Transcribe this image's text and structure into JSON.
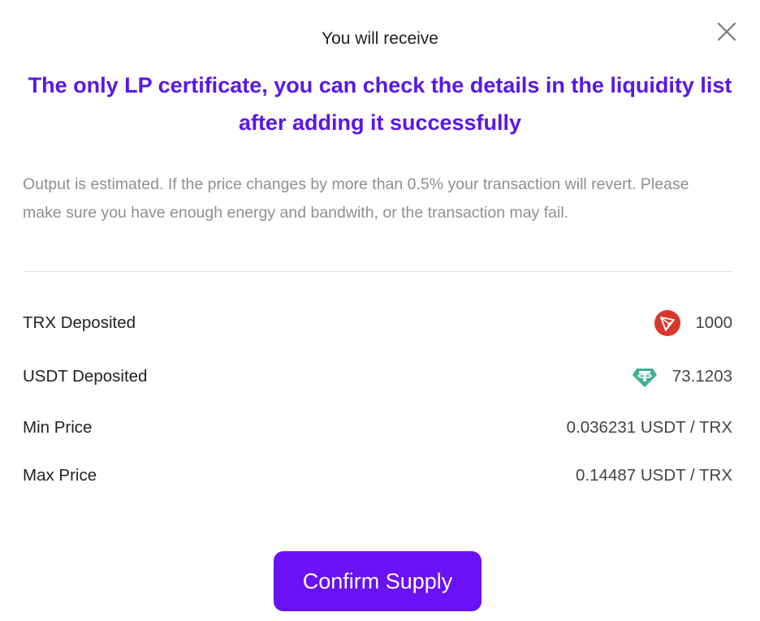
{
  "modal": {
    "subtitle": "You will receive",
    "headline": "The only LP certificate, you can check the details in the liquidity list after adding it successfully",
    "notice": "Output is estimated. If the price changes by more than 0.5% your transaction will revert. Please make sure you have enough energy and bandwith, or the transaction may fail.",
    "close_icon": "close-icon"
  },
  "details": [
    {
      "label": "TRX Deposited",
      "value": "1000",
      "icon": "trx-icon"
    },
    {
      "label": "USDT Deposited",
      "value": "73.1203",
      "icon": "usdt-icon"
    },
    {
      "label": "Min Price",
      "value": "0.036231 USDT / TRX"
    },
    {
      "label": "Max Price",
      "value": "0.14487 USDT / TRX"
    }
  ],
  "actions": {
    "confirm_label": "Confirm Supply"
  },
  "colors": {
    "accent": "#6a11f5",
    "headline": "#5a17e8",
    "trx_red": "#d9372c",
    "usdt_green": "#3fb08f",
    "muted_text": "#8f8f8f"
  }
}
